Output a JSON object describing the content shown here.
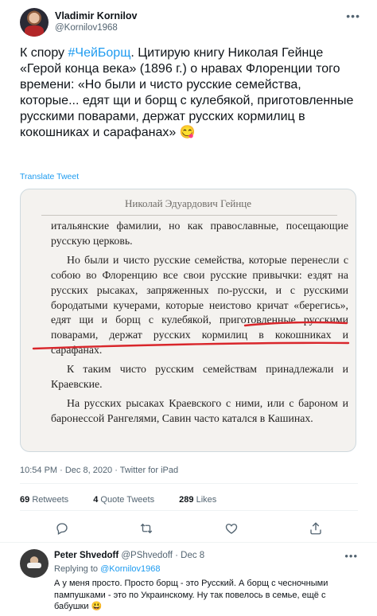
{
  "tweet": {
    "author_name": "Vladimir Kornilov",
    "author_handle": "@Kornilov1968",
    "more_icon": "more-horizontal-icon",
    "text_before": "К спору ",
    "hashtag": "#ЧейБорщ",
    "text_after": ". Цитирую книгу Николая Гейнце «Герой конца века» (1896 г.) о нравах Флоренции того времени: «Но были и чисто русские семейства, которые... едят щи и борщ с кулебякой, приготовленные русскими поварами, держат русских кормилиц в кокошниках и сарафанах» 😋",
    "translate_label": "Translate Tweet",
    "photo": {
      "book_header": "Николай Эдуардович Гейнце",
      "paragraphs": [
        "итальянские фамилии, но как православные, посещающие русскую церковь.",
        "Но были и чисто русские семейства, которые перенесли с собою во Флоренцию все свои русские привычки: ездят на русских рысаках, запряженных по-русски, и с русскими бородатыми кучерами, которые неистово кричат «берегись», едят щи и борщ с кулебякой, приготовленные русскими поварами, держат русских кормилиц в кокошниках и сарафанах.",
        "К таким чисто русским семействам принадлежали и Краевские.",
        "На русских рысаках Краевского с ними, или с бароном и баронессой Рангелями, Савин часто катался в Кашинах."
      ]
    },
    "timestamp": "10:54 PM · Dec 8, 2020 · Twitter for iPad",
    "stats": {
      "retweets_count": "69",
      "retweets_label": "Retweets",
      "quotes_count": "4",
      "quotes_label": "Quote Tweets",
      "likes_count": "289",
      "likes_label": "Likes"
    },
    "actions": [
      "reply-icon",
      "retweet-icon",
      "like-icon",
      "share-icon"
    ]
  },
  "reply": {
    "author_name": "Peter Shvedoff",
    "author_handle": "@PShvedoff",
    "date": "· Dec 8",
    "replying_label": "Replying to ",
    "replying_mention": "@Kornilov1968",
    "text": "А у меня просто. Просто борщ - это Русский.  А борщ с чесночными пампушками - это по Украинскому. Ну так повелось в семье, ещё с бабушки 😃"
  },
  "colors": {
    "accent": "#1d9bf0",
    "secondary_text": "#536471",
    "underline": "#d9262b"
  }
}
